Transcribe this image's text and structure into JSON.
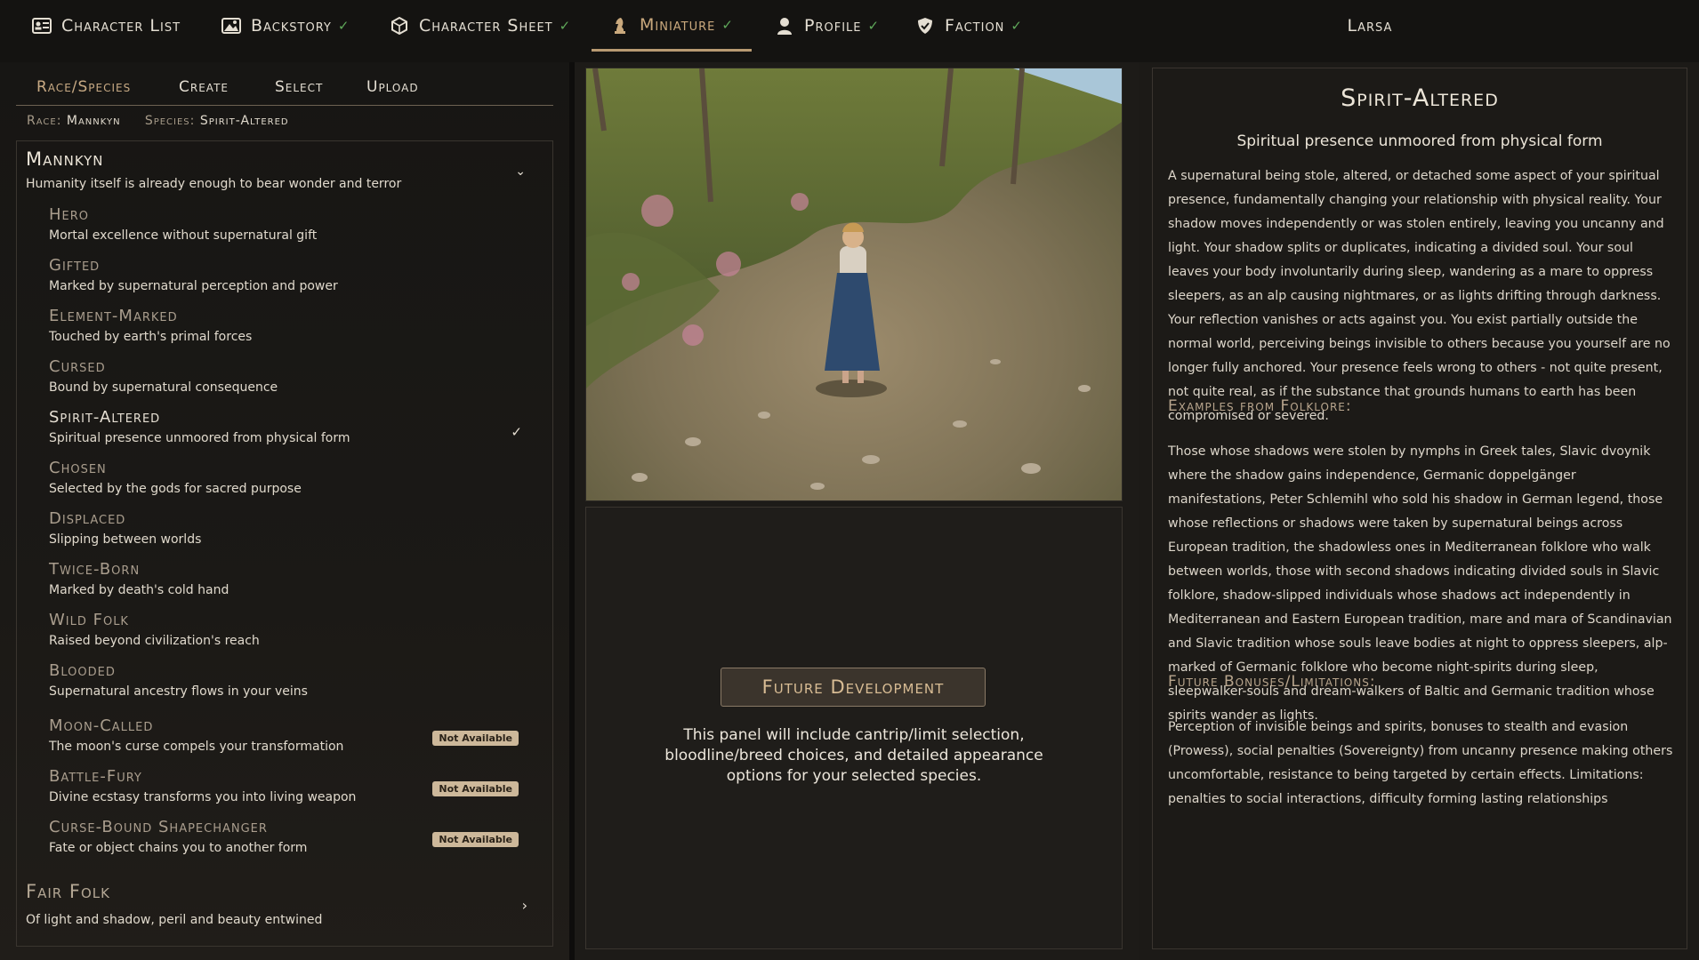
{
  "nav": {
    "tabs": [
      {
        "label": "Character List",
        "check": ""
      },
      {
        "label": "Backstory",
        "check": "✓"
      },
      {
        "label": "Character Sheet",
        "check": "✓"
      },
      {
        "label": "Miniature",
        "check": "✓"
      },
      {
        "label": "Profile",
        "check": "✓"
      },
      {
        "label": "Faction",
        "check": "✓"
      }
    ],
    "active_tab": "Miniature",
    "username": "Larsa"
  },
  "left": {
    "subtabs": [
      "Race/Species",
      "Create",
      "Select",
      "Upload"
    ],
    "active_subtab": "Race/Species",
    "race_label": "Race:",
    "race_value": "Mannkyn",
    "species_label": "Species:",
    "species_value": "Spirit-Altered",
    "group": {
      "title": "Mannkyn",
      "desc": "Humanity itself is already enough to bear wonder and terror"
    },
    "items": [
      {
        "title": "Hero",
        "desc": "Mortal excellence without supernatural gift"
      },
      {
        "title": "Gifted",
        "desc": "Marked by supernatural perception and power"
      },
      {
        "title": "Element-Marked",
        "desc": "Touched by earth's primal forces"
      },
      {
        "title": "Cursed",
        "desc": "Bound by supernatural consequence"
      },
      {
        "title": "Spirit-Altered",
        "desc": "Spiritual presence unmoored from physical form",
        "check": "✓"
      },
      {
        "title": "Chosen",
        "desc": "Selected by the gods for sacred purpose"
      },
      {
        "title": "Displaced",
        "desc": "Slipping between worlds"
      },
      {
        "title": "Twice-Born",
        "desc": "Marked by death's cold hand"
      },
      {
        "title": "Wild Folk",
        "desc": "Raised beyond civilization's reach"
      },
      {
        "title": "Blooded",
        "desc": "Supernatural ancestry flows in your veins"
      },
      {
        "title": "Moon-Called",
        "desc": "The moon's curse compels your transformation",
        "badge": "Not Available"
      },
      {
        "title": "Battle-Fury",
        "desc": "Divine ecstasy transforms you into living weapon",
        "badge": "Not Available"
      },
      {
        "title": "Curse-Bound Shapechanger",
        "desc": "Fate or object chains you to another form",
        "badge": "Not Available"
      }
    ],
    "group2": {
      "title": "Fair Folk",
      "desc": "Of light and shadow, peril and beauty entwined"
    }
  },
  "middle": {
    "dev_title": "Future Development",
    "dev_text": "This panel will include cantrip/limit selection, bloodline/breed choices, and detailed appearance options for your selected species."
  },
  "right": {
    "title": "Spirit-Altered",
    "subtitle": "Spiritual presence unmoored from physical form",
    "description": "A supernatural being stole, altered, or detached some aspect of your spiritual presence, fundamentally changing your relationship with physical reality. Your shadow moves independently or was stolen entirely, leaving you uncanny and light. Your shadow splits or duplicates, indicating a divided soul. Your soul leaves your body involuntarily during sleep, wandering as a mare to oppress sleepers, as an alp causing nightmares, or as lights drifting through darkness. Your reflection vanishes or acts against you. You exist partially outside the normal world, perceiving beings invisible to others because you yourself are no longer fully anchored. Your presence feels wrong to others - not quite present, not quite real, as if the substance that grounds humans to earth has been compromised or severed.",
    "examples_heading": "Examples from Folklore:",
    "examples": "Those whose shadows were stolen by nymphs in Greek tales, Slavic dvoynik where the shadow gains independence, Germanic doppelgänger manifestations, Peter Schlemihl who sold his shadow in German legend, those whose reflections or shadows were taken by supernatural beings across European tradition, the shadowless ones in Mediterranean folklore who walk between worlds, those with second shadows indicating divided souls in Slavic folklore, shadow-slipped individuals whose shadows act independently in Mediterranean and Eastern European tradition, mare and mara of Scandinavian and Slavic tradition whose souls leave bodies at night to oppress sleepers, alp-marked of Germanic folklore who become night-spirits during sleep, sleepwalker-souls and dream-walkers of Baltic and Germanic tradition whose spirits wander as lights.",
    "bonuses_heading": "Future Bonuses/Limitations:",
    "bonuses": "Perception of invisible beings and spirits, bonuses to stealth and evasion (Prowess), social penalties (Sovereignty) from uncanny presence making others uncomfortable, resistance to being targeted by certain effects. Limitations: penalties to social interactions, difficulty forming lasting relationships"
  },
  "colors": {
    "accent": "#c8aa84",
    "check": "#5fa85a",
    "badge": "#cdb89a"
  }
}
